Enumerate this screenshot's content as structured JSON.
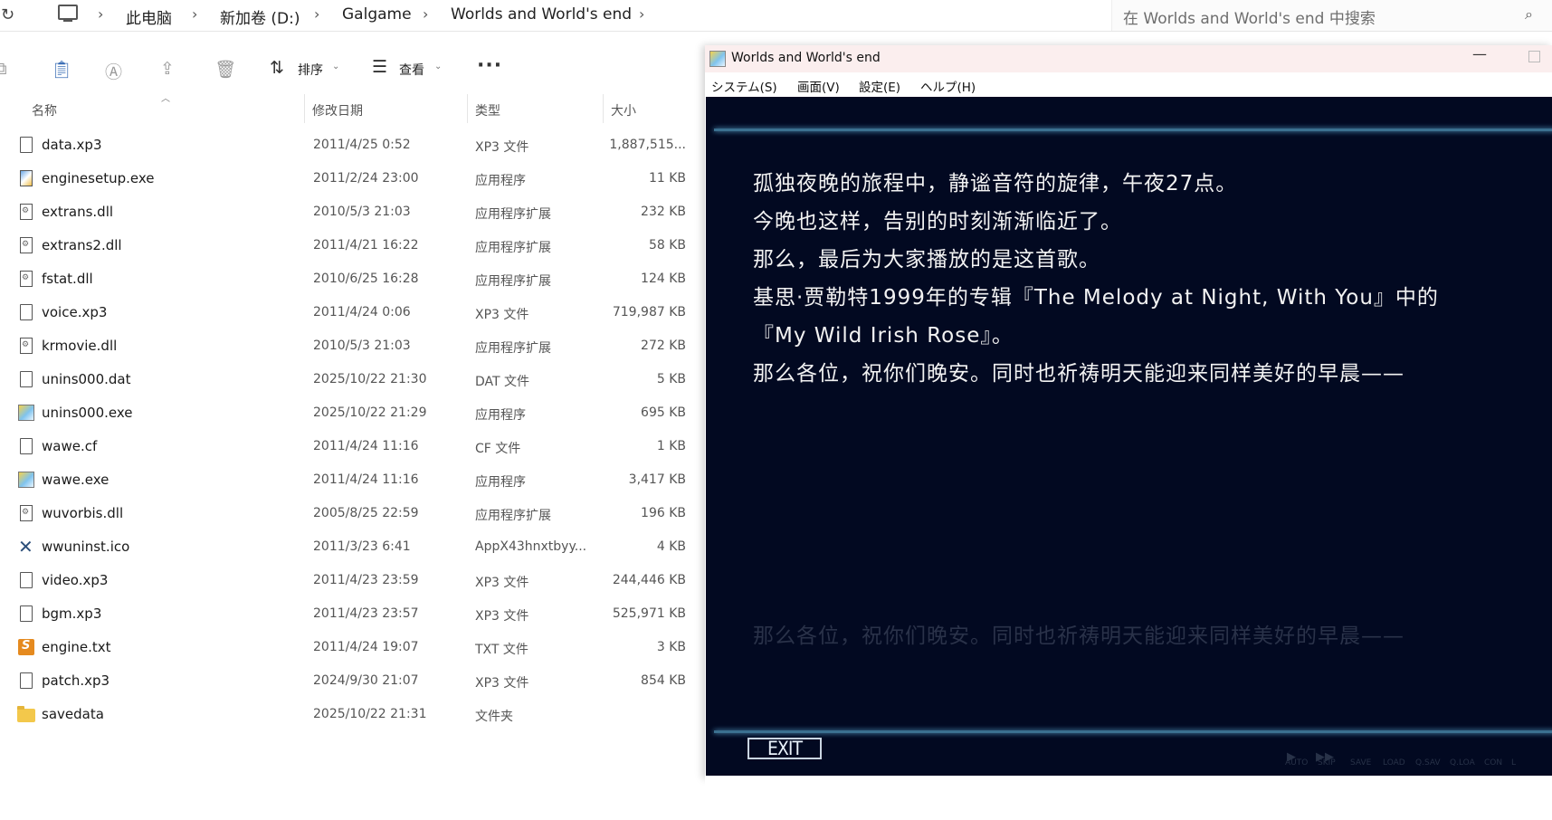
{
  "address_bar": {
    "breadcrumbs": [
      "此电脑",
      "新加卷 (D:)",
      "Galgame",
      "Worlds and World's end"
    ],
    "search_placeholder": "在 Worlds and World's end 中搜索"
  },
  "command_bar": {
    "sort_label": "排序",
    "view_label": "查看",
    "more_label": "···"
  },
  "columns": {
    "name": "名称",
    "date": "修改日期",
    "type": "类型",
    "size": "大小"
  },
  "files": [
    {
      "icon": "document-icon",
      "name": "data.xp3",
      "date": "2011/4/25 0:52",
      "type": "XP3 文件",
      "size": "1,887,515..."
    },
    {
      "icon": "installer-exe-icon",
      "name": "enginesetup.exe",
      "date": "2011/2/24 23:00",
      "type": "应用程序",
      "size": "11 KB"
    },
    {
      "icon": "dll-icon",
      "name": "extrans.dll",
      "date": "2010/5/3 21:03",
      "type": "应用程序扩展",
      "size": "232 KB"
    },
    {
      "icon": "dll-icon",
      "name": "extrans2.dll",
      "date": "2011/4/21 16:22",
      "type": "应用程序扩展",
      "size": "58 KB"
    },
    {
      "icon": "dll-icon",
      "name": "fstat.dll",
      "date": "2010/6/25 16:28",
      "type": "应用程序扩展",
      "size": "124 KB"
    },
    {
      "icon": "document-icon",
      "name": "voice.xp3",
      "date": "2011/4/24 0:06",
      "type": "XP3 文件",
      "size": "719,987 KB"
    },
    {
      "icon": "dll-icon",
      "name": "krmovie.dll",
      "date": "2010/5/3 21:03",
      "type": "应用程序扩展",
      "size": "272 KB"
    },
    {
      "icon": "document-icon",
      "name": "unins000.dat",
      "date": "2025/10/22 21:30",
      "type": "DAT 文件",
      "size": "5 KB"
    },
    {
      "icon": "game-exe-icon",
      "name": "unins000.exe",
      "date": "2025/10/22 21:29",
      "type": "应用程序",
      "size": "695 KB"
    },
    {
      "icon": "document-icon",
      "name": "wawe.cf",
      "date": "2011/4/24 11:16",
      "type": "CF 文件",
      "size": "1 KB"
    },
    {
      "icon": "game-exe-icon",
      "name": "wawe.exe",
      "date": "2011/4/24 11:16",
      "type": "应用程序",
      "size": "3,417 KB"
    },
    {
      "icon": "dll-icon",
      "name": "wuvorbis.dll",
      "date": "2005/8/25 22:59",
      "type": "应用程序扩展",
      "size": "196 KB"
    },
    {
      "icon": "ico-file-icon",
      "name": "wwuninst.ico",
      "date": "2011/3/23 6:41",
      "type": "AppX43hnxtbyy...",
      "size": "4 KB"
    },
    {
      "icon": "document-icon",
      "name": "video.xp3",
      "date": "2011/4/23 23:59",
      "type": "XP3 文件",
      "size": "244,446 KB"
    },
    {
      "icon": "document-icon",
      "name": "bgm.xp3",
      "date": "2011/4/23 23:57",
      "type": "XP3 文件",
      "size": "525,971 KB"
    },
    {
      "icon": "text-file-icon",
      "name": "engine.txt",
      "date": "2011/4/24 19:07",
      "type": "TXT 文件",
      "size": "3 KB"
    },
    {
      "icon": "document-icon",
      "name": "patch.xp3",
      "date": "2024/9/30 21:07",
      "type": "XP3 文件",
      "size": "854 KB"
    },
    {
      "icon": "folder-icon",
      "name": "savedata",
      "date": "2025/10/22 21:31",
      "type": "文件夹",
      "size": ""
    }
  ],
  "game_window": {
    "title": "Worlds and World's end",
    "minimize_label": "—",
    "menus": [
      "システム(S)",
      "画面(V)",
      "設定(E)",
      "ヘルプ(H)"
    ],
    "lines": [
      "孤独夜晚的旅程中，静谧音符的旋律，午夜27点。",
      "今晚也这样，告别的时刻渐渐临近了。",
      "那么，最后为大家播放的是这首歌。",
      "基思·贾勒特1999年的专辑『The Melody at Night,  With You』中的",
      "『My Wild Irish Rose』。",
      "那么各位，祝你们晚安。同时也祈祷明天能迎来同样美好的早晨——"
    ],
    "ghost_line": "那么各位，祝你们晚安。同时也祈祷明天能迎来同样美好的早晨——",
    "exit_label": "EXIT",
    "controls": [
      "AUTO",
      "SKIP",
      "SAVE",
      "LOAD",
      "Q.SAV",
      "Q.LOA",
      "CON",
      "L"
    ]
  }
}
